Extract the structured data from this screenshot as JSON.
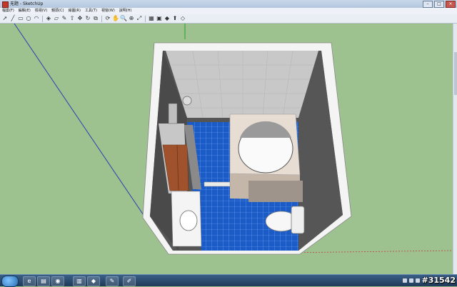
{
  "window": {
    "title": "无题 - SketchUp",
    "buttons": [
      "–",
      "□",
      "×"
    ]
  },
  "menus": [
    "檔案(F)",
    "編輯(E)",
    "檢視(V)",
    "鏡頭(C)",
    "繪圖(R)",
    "工具(T)",
    "視窗(W)",
    "說明(H)"
  ],
  "toolbar": {
    "tools": [
      {
        "name": "select-tool-icon",
        "glyph": "➚"
      },
      {
        "name": "line-tool-icon",
        "glyph": "╱"
      },
      {
        "name": "rectangle-tool-icon",
        "glyph": "▭"
      },
      {
        "name": "circle-tool-icon",
        "glyph": "○"
      },
      {
        "name": "arc-tool-icon",
        "glyph": "◠"
      },
      {
        "name": "paint-bucket-icon",
        "glyph": "◈"
      },
      {
        "name": "eraser-icon",
        "glyph": "▱"
      },
      {
        "name": "tape-measure-icon",
        "glyph": "✎"
      },
      {
        "name": "push-pull-icon",
        "glyph": "⇧"
      },
      {
        "name": "move-icon",
        "glyph": "✥"
      },
      {
        "name": "rotate-icon",
        "glyph": "↻"
      },
      {
        "name": "offset-icon",
        "glyph": "⧉"
      },
      {
        "name": "orbit-icon",
        "glyph": "⟳"
      },
      {
        "name": "pan-icon",
        "glyph": "✋"
      },
      {
        "name": "zoom-icon",
        "glyph": "🔍"
      },
      {
        "name": "zoom-window-icon",
        "glyph": "⊕"
      },
      {
        "name": "zoom-extents-icon",
        "glyph": "⤢"
      },
      {
        "name": "warehouse-icon",
        "glyph": "▦"
      },
      {
        "name": "components-icon",
        "glyph": "▣"
      },
      {
        "name": "ruby-icon",
        "glyph": "◆"
      },
      {
        "name": "share-model-icon",
        "glyph": "⬆"
      },
      {
        "name": "help-icon",
        "glyph": "◇"
      }
    ]
  },
  "watermark": "#31542",
  "colors": {
    "ground": "#9ec28f",
    "tile_blue": "#1b5bc8",
    "wall_gray": "#c9c9c9",
    "wall_dark": "#4a4a4a",
    "cabinet_wood": "#a0522d"
  }
}
